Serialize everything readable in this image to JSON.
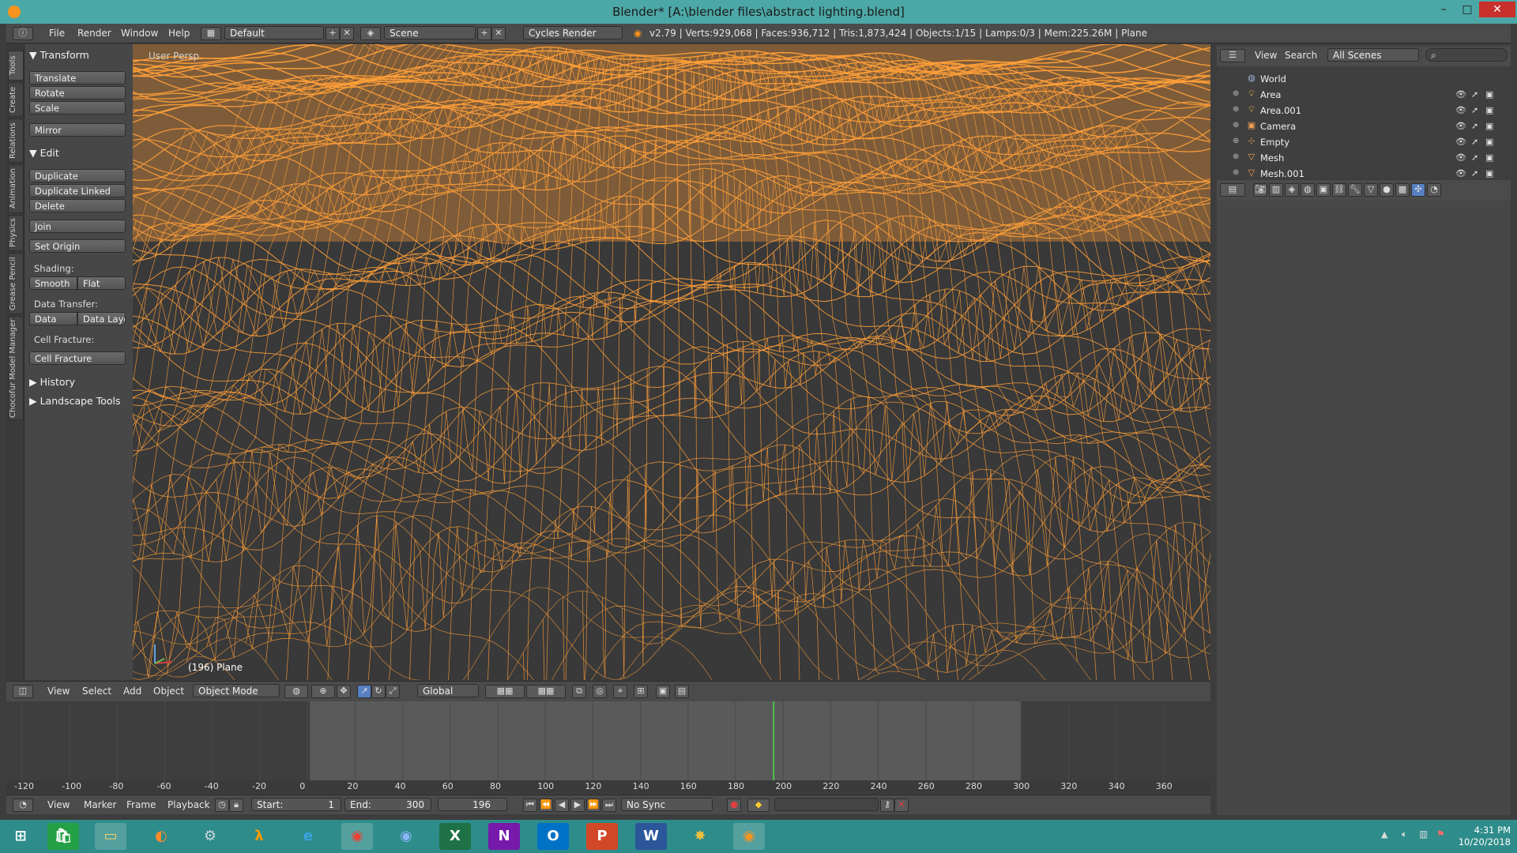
{
  "window": {
    "title": "Blender* [A:\\blender files\\abstract lighting.blend]",
    "controls": {
      "minimize": "–",
      "maximize": "□",
      "close": "✕"
    }
  },
  "topbar": {
    "menus": [
      "File",
      "Render",
      "Window",
      "Help"
    ],
    "layout": "Default",
    "scene": "Scene",
    "engine": "Cycles Render",
    "stats": "v2.79 | Verts:929,068 | Faces:936,712 | Tris:1,873,424 | Objects:1/15 | Lamps:0/3 | Mem:225.26M | Plane"
  },
  "tool_tabs": [
    "Tools",
    "Create",
    "Relations",
    "Animation",
    "Physics",
    "Grease Pencil",
    "Chocofur Model Manager"
  ],
  "toolshelf": {
    "transform_header": "Transform",
    "translate": "Translate",
    "rotate": "Rotate",
    "scale": "Scale",
    "mirror": "Mirror",
    "edit_header": "Edit",
    "duplicate": "Duplicate",
    "duplicate_linked": "Duplicate Linked",
    "delete": "Delete",
    "join": "Join",
    "set_origin": "Set Origin",
    "shading_label": "Shading:",
    "smooth": "Smooth",
    "flat": "Flat",
    "data_transfer_label": "Data Transfer:",
    "data": "Data",
    "data_layout": "Data Layo",
    "cell_fracture_label": "Cell Fracture:",
    "cell_fracture": "Cell Fracture",
    "history_header": "History",
    "landscape_header": "Landscape Tools"
  },
  "viewport": {
    "view_name": "User Persp",
    "object_label": "(196) Plane",
    "wire_color": "#ff9f38",
    "bg_color": "#393939"
  },
  "viewport_header": {
    "menus": [
      "View",
      "Select",
      "Add",
      "Object"
    ],
    "mode": "Object Mode",
    "orientation": "Global"
  },
  "timeline": {
    "ticks": [
      "-120",
      "-100",
      "-80",
      "-60",
      "-40",
      "-20",
      "0",
      "20",
      "40",
      "60",
      "80",
      "100",
      "120",
      "140",
      "160",
      "180",
      "200",
      "220",
      "240",
      "260",
      "280",
      "300",
      "320",
      "340",
      "360"
    ],
    "menus": [
      "View",
      "Marker",
      "Frame",
      "Playback"
    ],
    "start_label": "Start:",
    "start": "1",
    "end_label": "End:",
    "end": "300",
    "current": "196",
    "sync": "No Sync"
  },
  "outliner": {
    "menus": [
      "View",
      "Search"
    ],
    "scope": "All Scenes",
    "items": [
      {
        "name": "World",
        "icon": "world-icon"
      },
      {
        "name": "Area",
        "icon": "lamp-icon"
      },
      {
        "name": "Area.001",
        "icon": "lamp-icon"
      },
      {
        "name": "Camera",
        "icon": "camera-icon"
      },
      {
        "name": "Empty",
        "icon": "empty-icon"
      },
      {
        "name": "Mesh",
        "icon": "mesh-icon"
      },
      {
        "name": "Mesh.001",
        "icon": "mesh-icon"
      }
    ]
  },
  "taskbar": {
    "time": "4:31 PM",
    "date": "10/20/2018"
  }
}
